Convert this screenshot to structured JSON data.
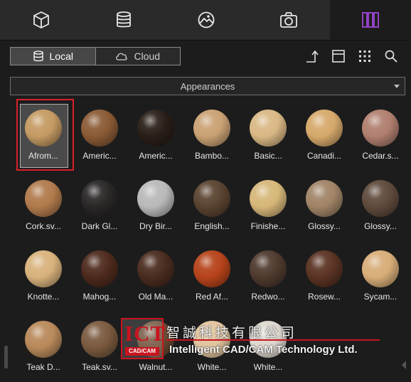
{
  "tabs": [
    {
      "name": "cube-icon",
      "active": false
    },
    {
      "name": "database-icon",
      "active": false
    },
    {
      "name": "image-icon",
      "active": false
    },
    {
      "name": "camera-icon",
      "active": false
    },
    {
      "name": "library-icon",
      "active": true
    }
  ],
  "source_toggle": {
    "local_label": "Local",
    "cloud_label": "Cloud",
    "selected": "Local"
  },
  "toolbar": [
    "move-up-icon",
    "layout-icon",
    "grid-view-icon",
    "search-icon"
  ],
  "dropdown": {
    "value": "Appearances"
  },
  "materials": [
    {
      "label": "Afrom...",
      "color": "#c49a62",
      "selected": true
    },
    {
      "label": "Americ...",
      "color": "#8a5a35"
    },
    {
      "label": "Americ...",
      "color": "#2a1e18"
    },
    {
      "label": "Bambo...",
      "color": "#caa174"
    },
    {
      "label": "Basic...",
      "color": "#d9b884"
    },
    {
      "label": "Canadi...",
      "color": "#d6a96b"
    },
    {
      "label": "Cedar.s...",
      "color": "#b07f6f"
    },
    {
      "label": "Cork.sv...",
      "color": "#b07a4c"
    },
    {
      "label": "Dark Gl...",
      "color": "#2a2727"
    },
    {
      "label": "Dry Bir...",
      "color": "#b9b9b9"
    },
    {
      "label": "English...",
      "color": "#5a4330"
    },
    {
      "label": "Finishe...",
      "color": "#d6b779"
    },
    {
      "label": "Glossy...",
      "color": "#a08467"
    },
    {
      "label": "Glossy...",
      "color": "#5f4a3c"
    },
    {
      "label": "Knotte...",
      "color": "#d8b27c"
    },
    {
      "label": "Mahog...",
      "color": "#4e2a1d"
    },
    {
      "label": "Old Ma...",
      "color": "#4a2c1f"
    },
    {
      "label": "Red Af...",
      "color": "#b6431a"
    },
    {
      "label": "Redwo...",
      "color": "#4f3a2e"
    },
    {
      "label": "Rosew...",
      "color": "#5a3323"
    },
    {
      "label": "Sycam...",
      "color": "#d7ad78"
    },
    {
      "label": "Teak D...",
      "color": "#b8895a"
    },
    {
      "label": "Teak.sv...",
      "color": "#7a5a3f"
    },
    {
      "label": "Walnut...",
      "color": "#6a4a32"
    },
    {
      "label": "White...",
      "color": "#e0c49d"
    },
    {
      "label": "White...",
      "color": "#ddd7cf"
    }
  ],
  "watermark": {
    "logo_text": "ICT",
    "logo_sub": "CAD/CAM",
    "company_cn": "智誠科技有限公司",
    "company_en": "Intelligent CAD/CAM Technology Ltd."
  }
}
